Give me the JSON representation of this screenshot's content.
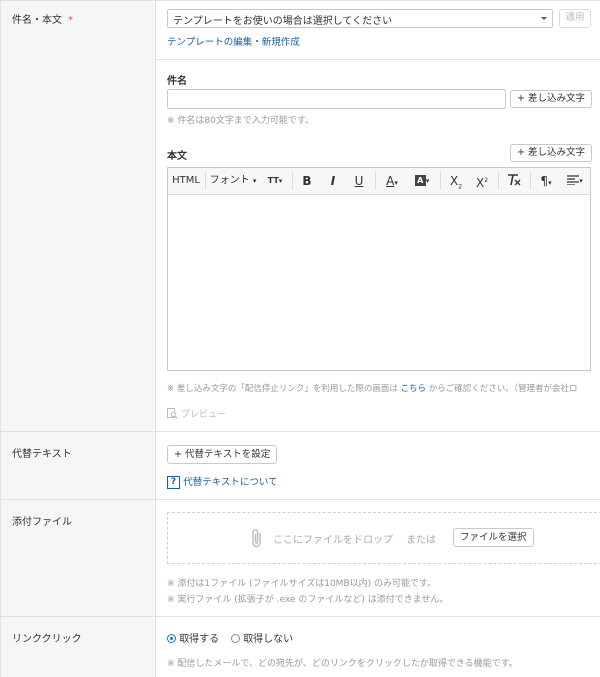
{
  "subject_body": {
    "label": "件名・本文",
    "required_mark": "*",
    "template_placeholder": "テンプレートをお使いの場合は選択してください",
    "apply_label": "適用",
    "template_edit_link": "テンプレートの編集・新規作成",
    "subject_label": "件名",
    "subject_value": "",
    "merge_label": "+ 差し込み文字",
    "subject_note": "※ 件名は80文字まで入力可能です。",
    "body_label": "本文",
    "toolbar": {
      "html": "HTML",
      "font": "フォント",
      "size_icon": "TT",
      "bold": "B",
      "italic": "I",
      "underline": "U",
      "font_color": "A",
      "bg_color": "A",
      "subscript": "X",
      "subscript_mark": "2",
      "superscript": "X",
      "superscript_mark": "2",
      "pilcrow": "¶"
    },
    "body_value": "",
    "unsubscribe_note_pre": "※ 差し込み文字の「配信停止リンク」を利用した際の画面は",
    "unsubscribe_link": "こちら",
    "unsubscribe_note_post": "からご確認ください。（管理者が会社ロ",
    "preview_label": "プレビュー"
  },
  "alt_text": {
    "label": "代替テキスト",
    "set_button": "+ 代替テキストを設定",
    "help_icon": "?",
    "about_link": "代替テキストについて"
  },
  "attachment": {
    "label": "添付ファイル",
    "drop_text": "ここにファイルをドロップ",
    "or_text": "または",
    "select_button": "ファイルを選択",
    "note1": "※ 添付は1ファイル (ファイルサイズは10MB以内) のみ可能です。",
    "note2": "※ 実行ファイル (拡張子が .exe のファイルなど) は添付できません。"
  },
  "link_click": {
    "label": "リンククリック",
    "option_track": "取得する",
    "option_no_track": "取得しない",
    "selected": "取得する",
    "note": "※ 配信したメールで、どの宛先が、どのリンクをクリックしたか取得できる機能です。"
  },
  "colors": {
    "link": "#1a5fa6",
    "radio": "#1a73c6",
    "required": "#d9534f",
    "label_bg": "#f5f6f7"
  }
}
